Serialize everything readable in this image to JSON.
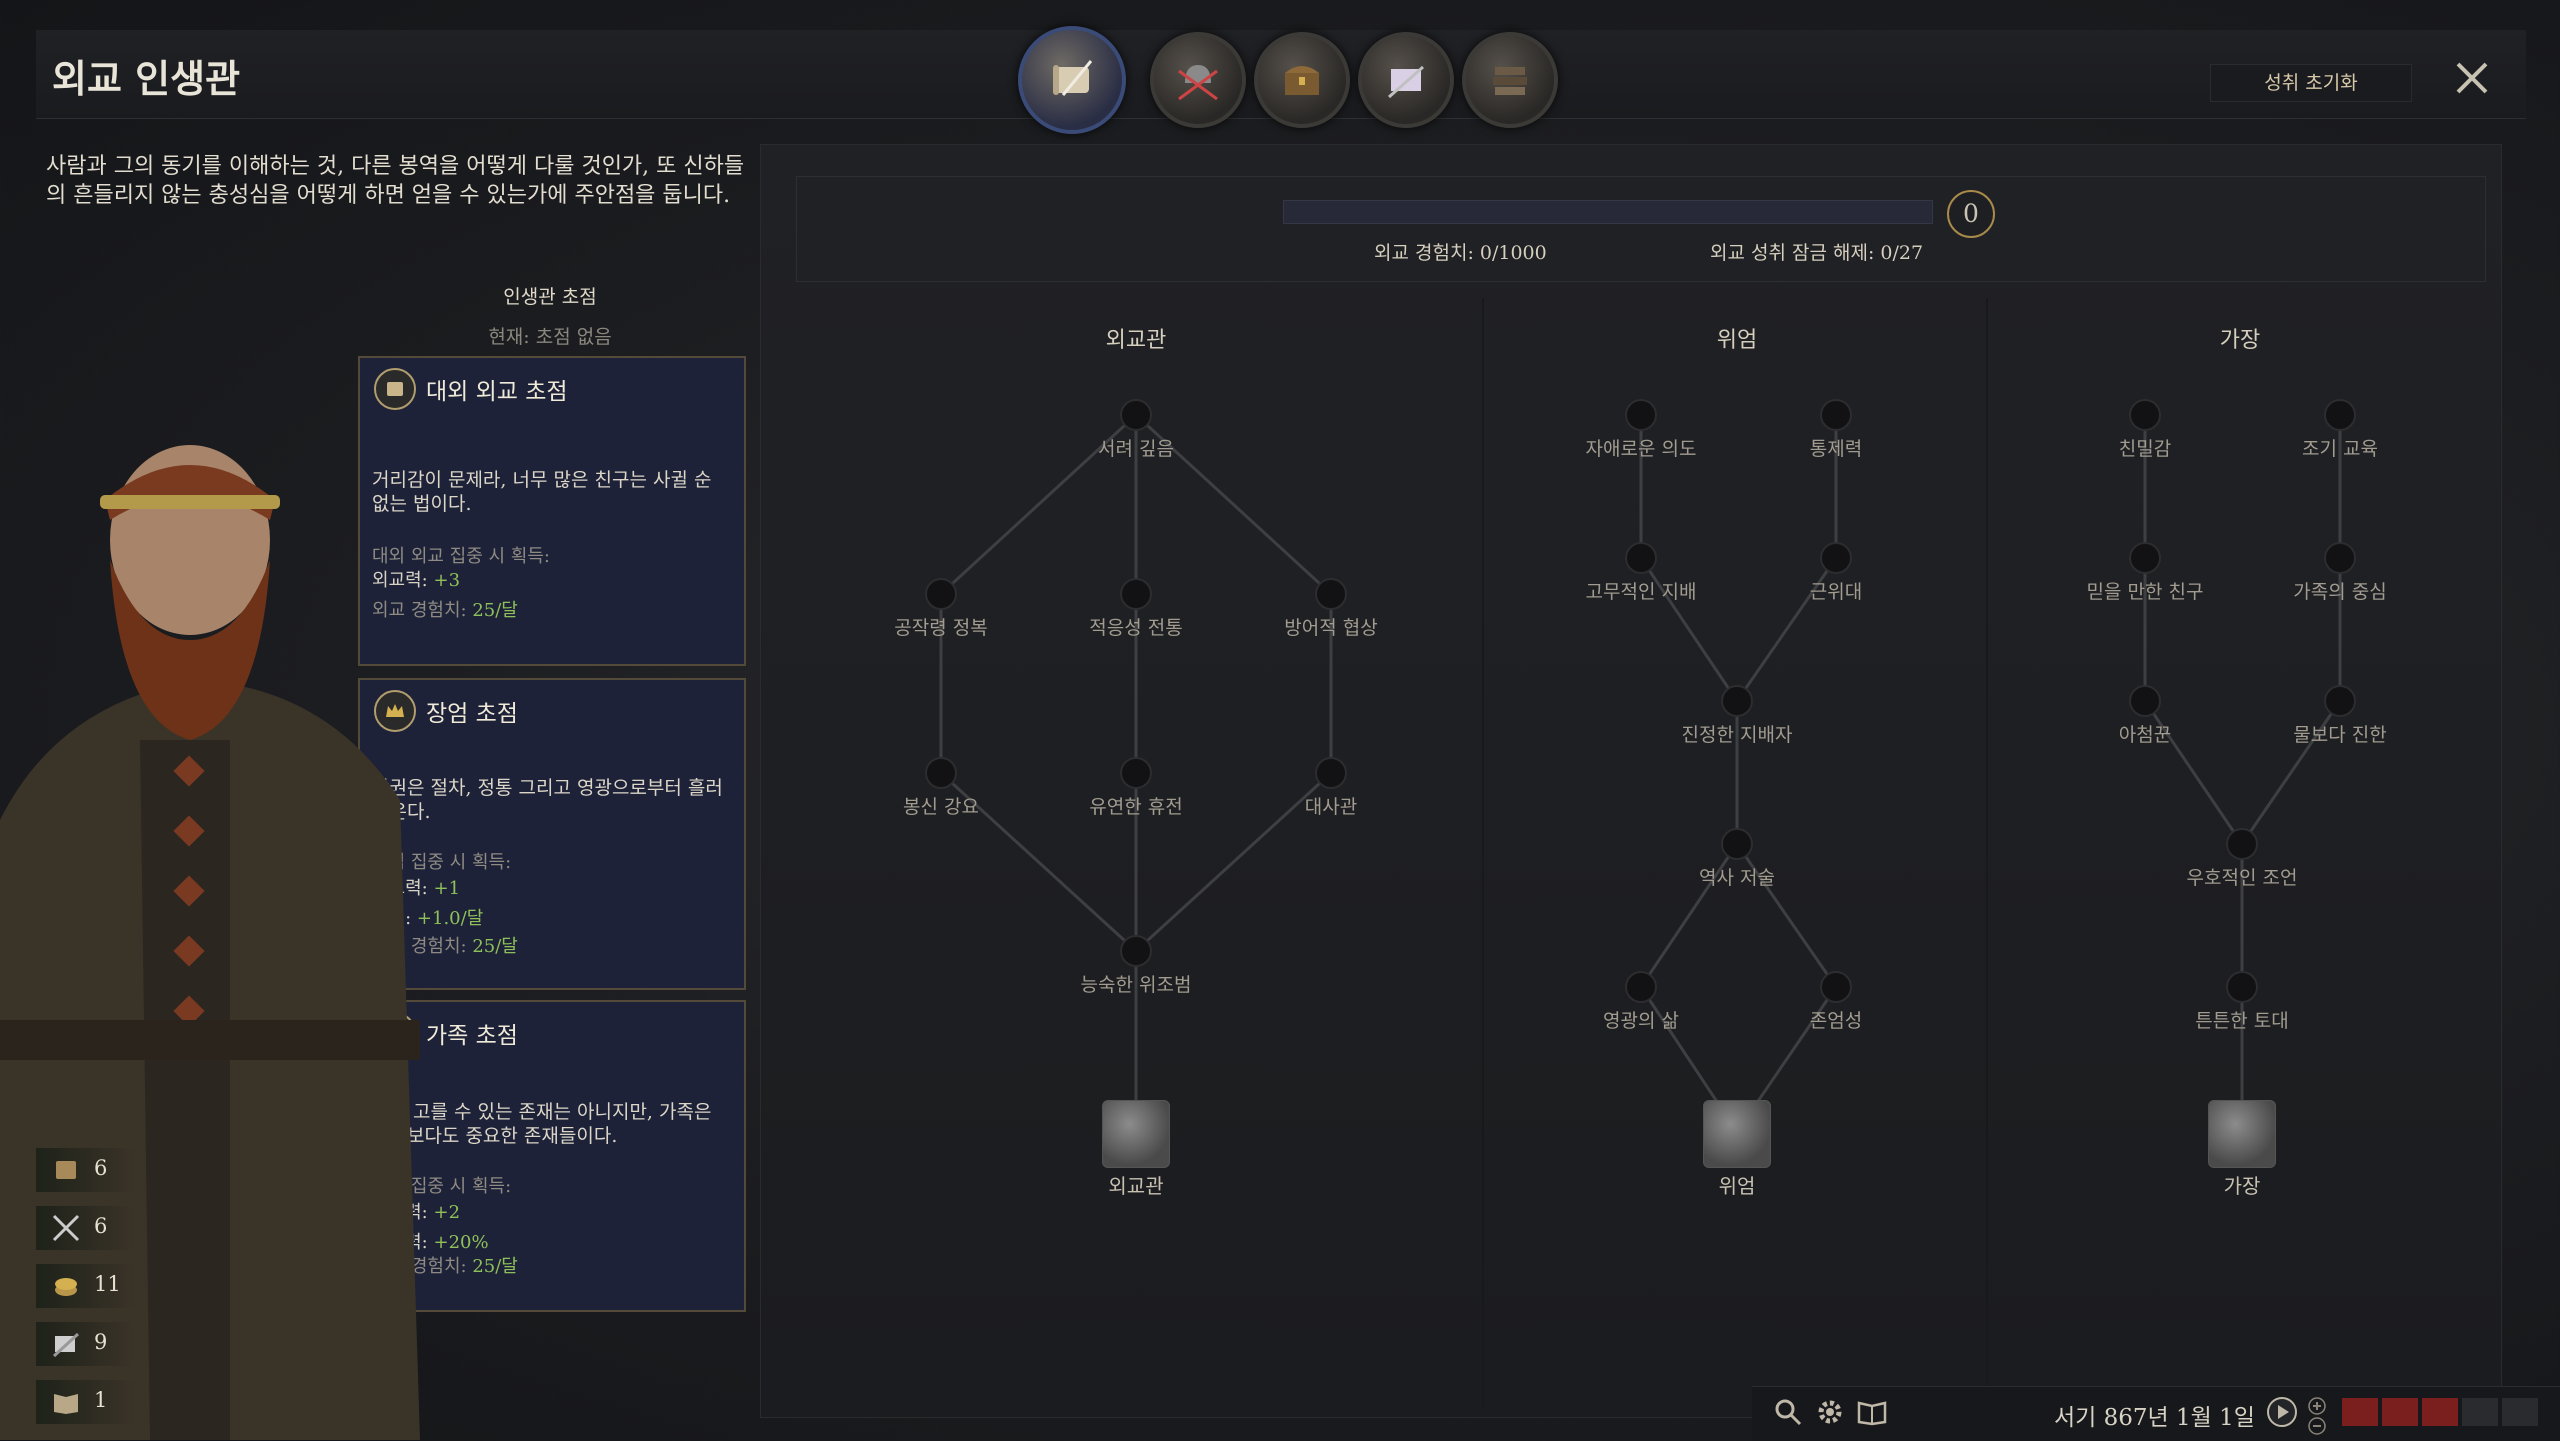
{
  "header": {
    "title": "외교 인생관",
    "reset_label": "성취 초기화",
    "tabs": [
      {
        "name": "diplomacy",
        "icon": "scroll-quill-icon",
        "active": true
      },
      {
        "name": "martial",
        "icon": "helmet-swords-icon",
        "active": false
      },
      {
        "name": "stewardship",
        "icon": "treasure-chest-icon",
        "active": false
      },
      {
        "name": "intrigue",
        "icon": "dagger-letter-icon",
        "active": false
      },
      {
        "name": "learning",
        "icon": "books-icon",
        "active": false
      }
    ]
  },
  "description": "사람과 그의 동기를 이해하는 것, 다른 봉역을 어떻게 다룰 것인가, 또 신하들의 흔들리지 않는 충성심을 어떻게 하면 얻을 수 있는가에 주안점을 둡니다.",
  "focus": {
    "heading": "인생관 초점",
    "current": "현재: 초점 없음",
    "cards": [
      {
        "title": "대외 외교 초점",
        "icon": "scroll-icon",
        "desc": "거리감이 문제라, 너무 많은 친구는 사귈 순 없는 법이다.",
        "gain_label": "대외 외교 집중 시 획득:",
        "lines": [
          {
            "key": "외교력:",
            "value": "+3"
          },
          {
            "key": "외교 경험치:",
            "value": "25/달"
          }
        ]
      },
      {
        "title": "장엄 초점",
        "icon": "crown-icon",
        "desc": "왕권은 절차, 정통 그리고 영광으로부터 흘러나온다.",
        "gain_label": "장엄 집중 시 획득:",
        "lines": [
          {
            "key": "외교력:",
            "value": "+1"
          },
          {
            "key": "위신:",
            "value": "+1.0/달"
          },
          {
            "key": "외교 경험치:",
            "value": "25/달"
          }
        ]
      },
      {
        "title": "가족 초점",
        "icon": "family-icon",
        "desc": "비록 고를 수 있는 존재는 아니지만, 가족은 누구보다도 중요한 존재들이다.",
        "gain_label": "가족 집중 시 획득:",
        "lines": [
          {
            "key": "외교력:",
            "value": "+2"
          },
          {
            "key": "수태력:",
            "value": "+20%"
          },
          {
            "key": "외교 경험치:",
            "value": "25/달"
          }
        ]
      }
    ]
  },
  "stats": [
    {
      "icon": "scroll-icon",
      "value": "6"
    },
    {
      "icon": "crossed-swords-icon",
      "value": "6"
    },
    {
      "icon": "coins-icon",
      "value": "11"
    },
    {
      "icon": "dagger-icon",
      "value": "9"
    },
    {
      "icon": "book-icon",
      "value": "1"
    }
  ],
  "progress": {
    "xp_label": "외교 경험치: 0/1000",
    "unlock_label": "외교 성취 잠금 해제: 0/27",
    "points": "0",
    "fraction": 0
  },
  "trees": [
    {
      "title": "외교관",
      "final": "외교관",
      "nodes": [
        "서려 깊음",
        "공작령 정복",
        "적응성 전통",
        "방어적 협상",
        "봉신 강요",
        "유연한 휴전",
        "대사관",
        "능숙한 위조범"
      ]
    },
    {
      "title": "위엄",
      "final": "위엄",
      "nodes": [
        "자애로운 의도",
        "통제력",
        "고무적인 지배",
        "근위대",
        "진정한 지배자",
        "역사 저술",
        "영광의 삶",
        "존엄성"
      ]
    },
    {
      "title": "가장",
      "final": "가장",
      "nodes": [
        "친밀감",
        "조기 교육",
        "믿을 만한 친구",
        "가족의 중심",
        "아첨꾼",
        "물보다 진한",
        "우호적인 조언",
        "튼튼한 토대"
      ]
    }
  ],
  "footer": {
    "date": "서기 867년 1월 1일",
    "icons": [
      "search-icon",
      "gear-icon",
      "book-icon"
    ]
  },
  "colors": {
    "accent": "#3c4a80",
    "gold": "#a88a4a",
    "positive": "#8fc15a",
    "card_bg": "#1d2238"
  }
}
